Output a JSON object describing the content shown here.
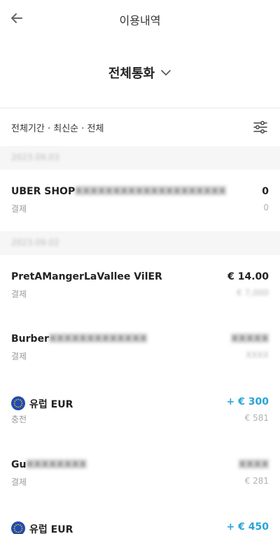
{
  "header": {
    "back_icon": "back-arrow-icon",
    "title": "이용내역"
  },
  "currency_selector": {
    "label": "전체통화",
    "icon": "chevron-down-icon"
  },
  "filter": {
    "summary": "전체기간 · 최신순 · 전체",
    "icon": "filter-sliders-icon"
  },
  "groups": [
    {
      "date": "2023.09.03"
    },
    {
      "date": "2023.09.02"
    }
  ],
  "transactions": [
    {
      "name": "UBER SHOP",
      "name_hidden": "XXXXXXXXXXXXXXXXXXXX",
      "amount": "0",
      "type": "결제",
      "sub_amount": "0"
    },
    {
      "name": "PretAMangerLaVallee VilER",
      "amount": "€ 14.00",
      "type": "결제",
      "sub_amount": "€ 7,000"
    },
    {
      "name": "Burber",
      "name_hidden": "XXXXXXXXXXXXX",
      "amount": "XXXXX",
      "type": "결제",
      "sub_amount": "XXXX"
    },
    {
      "name": "유럽 EUR",
      "icon": "eu-flag-icon",
      "amount": "+ € 300",
      "type": "충전",
      "sub_amount": "€ 581"
    },
    {
      "name": "Gu",
      "name_hidden": "XXXXXXXX",
      "amount": "XXXX",
      "type": "결제",
      "sub_amount": "€ 281"
    },
    {
      "name": "유럽 EUR",
      "icon": "eu-flag-icon",
      "amount": "+ € 450"
    }
  ],
  "colors": {
    "credit": "#2aa3d8",
    "eu_blue": "#1f4bb3",
    "eu_star": "#f5c400",
    "band": "#f6f6f6"
  }
}
